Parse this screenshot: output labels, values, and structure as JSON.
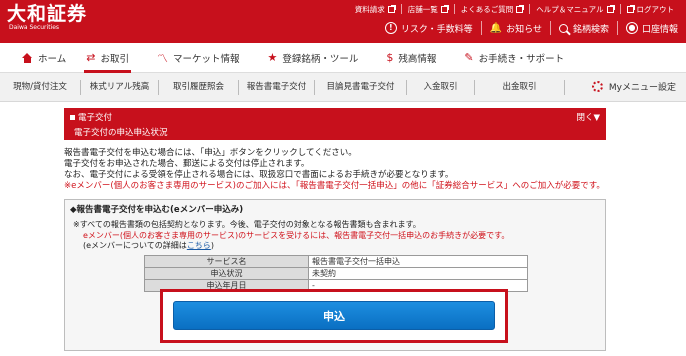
{
  "header": {
    "logo_main": "大和証券",
    "logo_sub": "Daiwa Securities",
    "top_links": [
      "資料請求",
      "店舗一覧",
      "よくあるご質問",
      "ヘルプ＆マニュアル",
      "ログアウト"
    ],
    "risk_link": "リスク・手数料等",
    "notice_link": "お知らせ",
    "search_link": "銘柄検索",
    "account_link": "口座情報"
  },
  "main_nav": [
    "ホーム",
    "お取引",
    "マーケット情報",
    "登録銘柄・ツール",
    "残高情報",
    "お手続き・サポート"
  ],
  "sub_nav": [
    "現物/貸付注文",
    "株式リアル残高",
    "取引履歴照会",
    "報告書電子交付",
    "目論見書電子交付",
    "入金取引",
    "出金取引"
  ],
  "my_menu": "Myメニュー設定",
  "panel": {
    "title": "電子交付",
    "subtitle": "電子交付の申込申込状況",
    "toggle": "閉く▼"
  },
  "description": {
    "line1": "報告書電子交付を申込む場合には、「申込」ボタンをクリックしてください。",
    "line2": "電子交付をお申込された場合、郵送による交付は停止されます。",
    "line3": "なお、電子交付による受領を停止される場合には、取扱窓口で書面によるお手続きが必要となります。",
    "line4": "※eメンバー(個人のお客さま専用のサービス)のご加入には、「報告書電子交付一括申込」の他に「証券総合サービス」へのご加入が必要です。"
  },
  "box": {
    "title": "◆報告書電子交付を申込む(eメンバー申込み)",
    "note1": "※すべての報告書類の包括契約となります。今後、電子交付の対象となる報告書類も含まれます。",
    "note2": "eメンバー(個人のお客さま専用のサービス)のサービスを受けるには、報告書電子交付一括申込のお手続きが必要です。",
    "note3_pre": "(eメンバーについての詳細は",
    "note3_link": "こちら",
    "note3_post": ")"
  },
  "table": [
    {
      "label": "サービス名",
      "value": "報告書電子交付一括申込"
    },
    {
      "label": "申込状況",
      "value": "未契約"
    },
    {
      "label": "申込年月日",
      "value": "-"
    }
  ],
  "apply_button": "申込",
  "colors": {
    "brand_red": "#c7101c",
    "button_blue": "#1d8ee0"
  }
}
